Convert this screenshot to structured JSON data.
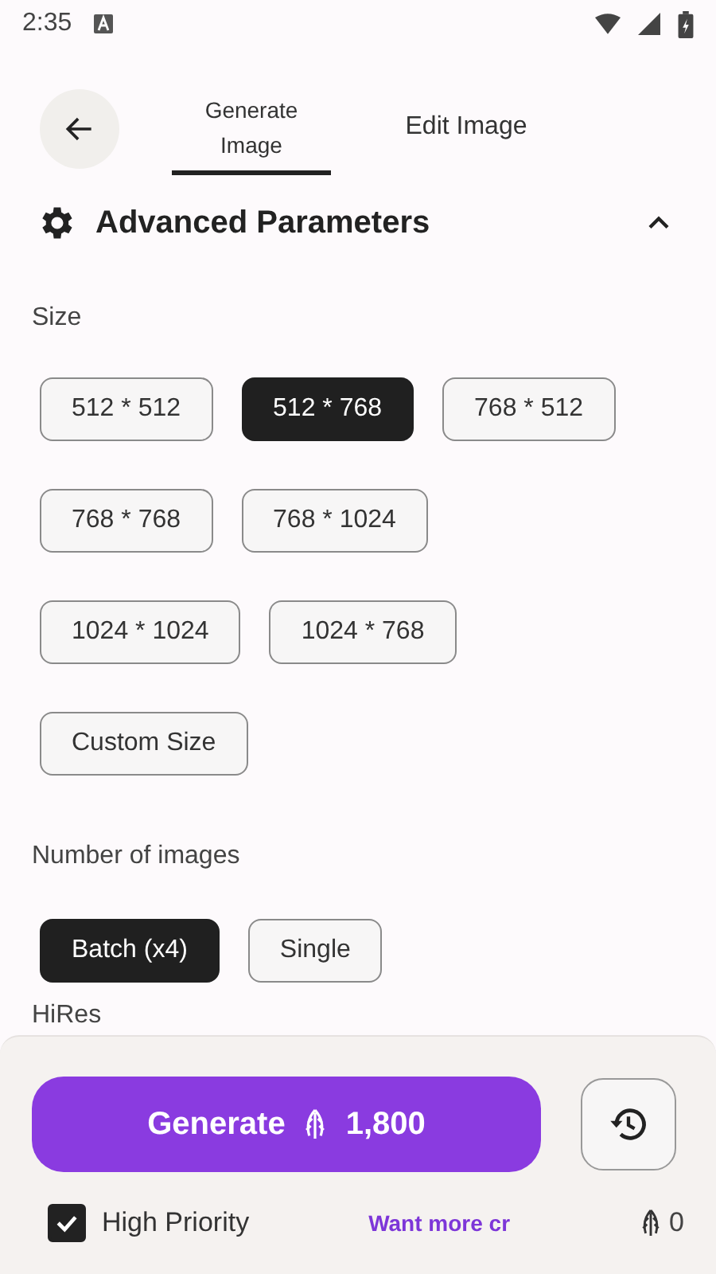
{
  "status_bar": {
    "time": "2:35"
  },
  "tabs": [
    {
      "label": "Generate Image",
      "selected": true
    },
    {
      "label": "Edit Image",
      "selected": false
    }
  ],
  "section": {
    "title": "Advanced Parameters",
    "expanded": true
  },
  "size": {
    "label": "Size",
    "options": [
      {
        "label": "512 * 512",
        "selected": false
      },
      {
        "label": "512 * 768",
        "selected": true
      },
      {
        "label": "768 * 512",
        "selected": false
      },
      {
        "label": "768 * 768",
        "selected": false
      },
      {
        "label": "768 * 1024",
        "selected": false
      },
      {
        "label": "1024 * 1024",
        "selected": false
      },
      {
        "label": "1024 * 768",
        "selected": false
      },
      {
        "label": "Custom Size",
        "selected": false
      }
    ]
  },
  "images": {
    "label": "Number of images",
    "options": [
      {
        "label": "Batch (x4)",
        "selected": true
      },
      {
        "label": "Single",
        "selected": false
      }
    ]
  },
  "next_label": "HiRes",
  "generate": {
    "label": "Generate",
    "cost": "1,800"
  },
  "high_priority": {
    "label": "High Priority",
    "checked": true
  },
  "credits_link": "Want more cr",
  "balance": "0"
}
